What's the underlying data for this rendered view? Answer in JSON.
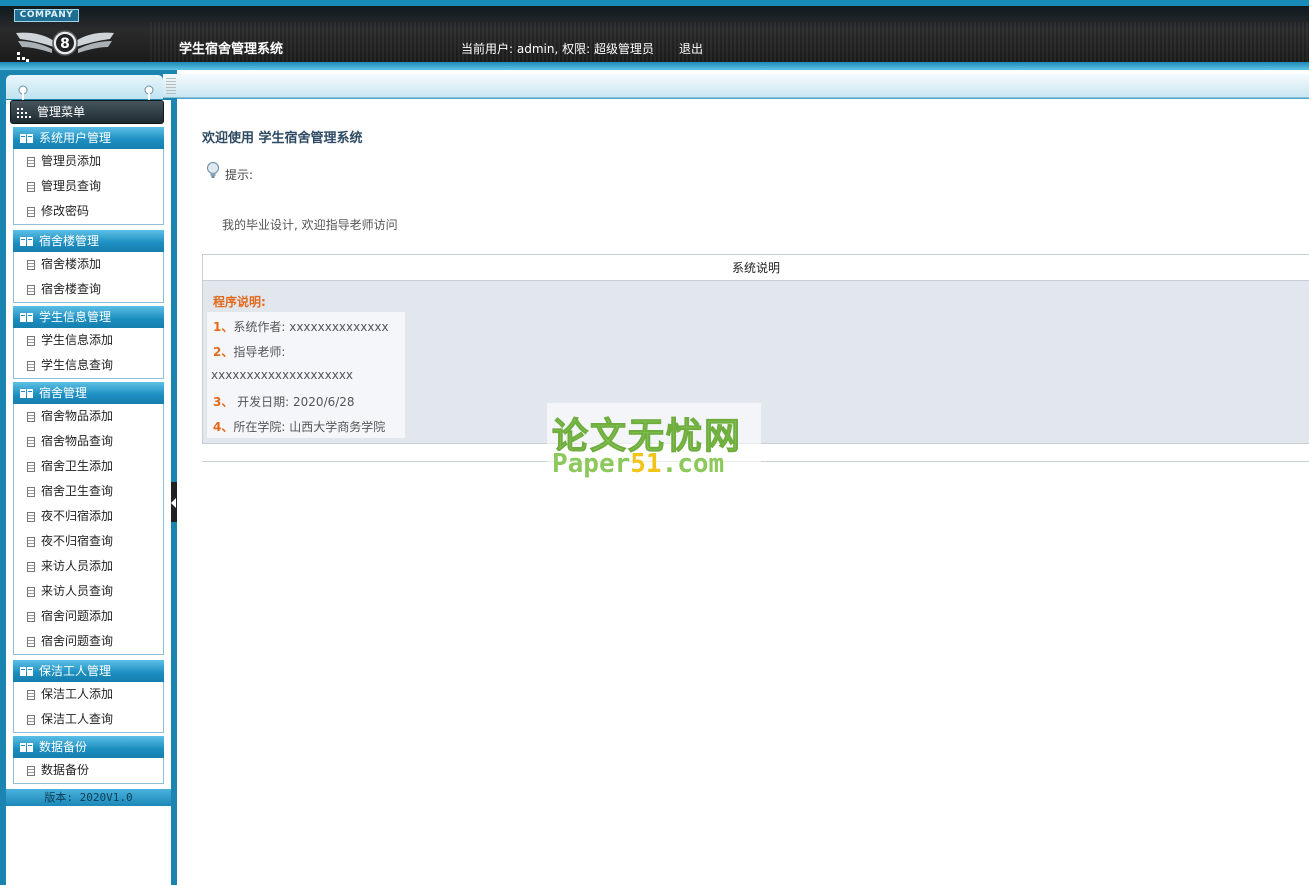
{
  "header": {
    "company": "COMPANY",
    "title": "学生宿舍管理系统",
    "user_info": "当前用户: admin, 权限: 超级管理员",
    "logout": "退出"
  },
  "sidebar": {
    "menu_title": "管理菜单",
    "groups": [
      {
        "title": "系统用户管理",
        "items": [
          "管理员添加",
          "管理员查询",
          "修改密码"
        ]
      },
      {
        "title": "宿舍楼管理",
        "items": [
          "宿舍楼添加",
          "宿舍楼查询"
        ]
      },
      {
        "title": "学生信息管理",
        "items": [
          "学生信息添加",
          "学生信息查询"
        ]
      },
      {
        "title": "宿舍管理",
        "items": [
          "宿舍物品添加",
          "宿舍物品查询",
          "宿舍卫生添加",
          "宿舍卫生查询",
          "夜不归宿添加",
          "夜不归宿查询",
          "来访人员添加",
          "来访人员查询",
          "宿舍问题添加",
          "宿舍问题查询"
        ]
      },
      {
        "title": "保洁工人管理",
        "items": [
          "保洁工人添加",
          "保洁工人查询"
        ]
      },
      {
        "title": "数据备份",
        "items": [
          "数据备份"
        ]
      }
    ],
    "version": "版本: 2020V1.0"
  },
  "main": {
    "welcome": "欢迎使用 学生宿舍管理系统",
    "tip_label": "提示:",
    "message": "我的毕业设计, 欢迎指导老师访问",
    "table_header": "系统说明",
    "program_title": "程序说明:",
    "lines": [
      {
        "num": "1、",
        "text": "系统作者: xxxxxxxxxxxxxx"
      },
      {
        "num": "2、",
        "text": "指导老师:"
      },
      {
        "num": "",
        "text": "xxxxxxxxxxxxxxxxxxxx"
      },
      {
        "num": "3、",
        "text": " 开发日期: 2020/6/28"
      },
      {
        "num": "4、",
        "text": "所在学院: 山西大学商务学院"
      }
    ]
  },
  "watermark": {
    "cn": "论文无忧网",
    "en_prefix": "Paper",
    "en_highlight": "51",
    "en_suffix": ".com"
  }
}
